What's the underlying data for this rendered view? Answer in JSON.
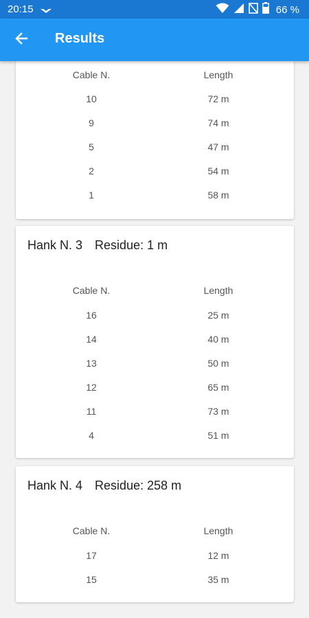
{
  "status_bar": {
    "time": "20:15",
    "battery": "66 %",
    "icons": [
      "notification-icon",
      "wifi-icon",
      "signal-icon",
      "no-sim-icon",
      "battery-icon"
    ]
  },
  "app_bar": {
    "title": "Results",
    "back_icon": "arrow-back-icon"
  },
  "columns": {
    "cable": "Cable N.",
    "length": "Length"
  },
  "colors": {
    "status_bar": "#1b78d2",
    "app_bar": "#2196f3",
    "background": "#f2f2f2",
    "card": "#ffffff"
  },
  "cards": [
    {
      "title": "",
      "residue": "",
      "rows": [
        {
          "cable": "10",
          "length": "72 m"
        },
        {
          "cable": "9",
          "length": "74 m"
        },
        {
          "cable": "5",
          "length": "47 m"
        },
        {
          "cable": "2",
          "length": "54 m"
        },
        {
          "cable": "1",
          "length": "58 m"
        }
      ]
    },
    {
      "title": "Hank N. 3",
      "residue": "Residue: 1 m",
      "rows": [
        {
          "cable": "16",
          "length": "25 m"
        },
        {
          "cable": "14",
          "length": "40 m"
        },
        {
          "cable": "13",
          "length": "50 m"
        },
        {
          "cable": "12",
          "length": "65 m"
        },
        {
          "cable": "11",
          "length": "73 m"
        },
        {
          "cable": "4",
          "length": "51 m"
        }
      ]
    },
    {
      "title": "Hank N. 4",
      "residue": "Residue: 258 m",
      "rows": [
        {
          "cable": "17",
          "length": "12 m"
        },
        {
          "cable": "15",
          "length": "35 m"
        }
      ]
    }
  ]
}
